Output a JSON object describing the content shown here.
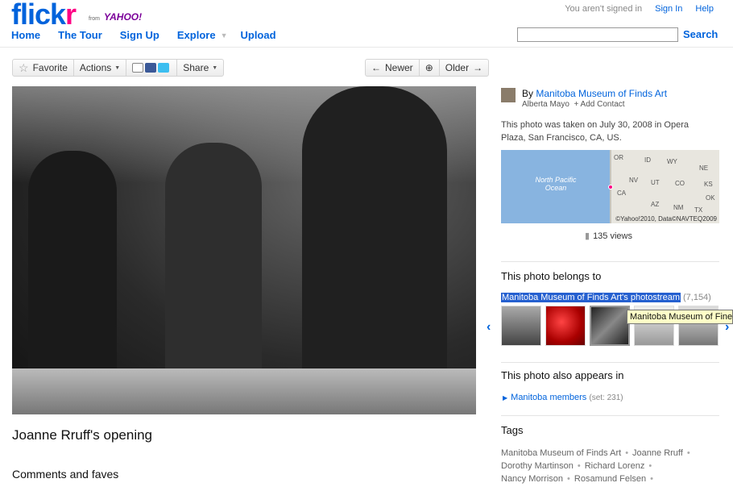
{
  "brand": {
    "flick": "flick",
    "r": "r",
    "from": "from",
    "yahoo": "YAHOO!"
  },
  "nav": {
    "home": "Home",
    "tour": "The Tour",
    "signup": "Sign Up",
    "explore": "Explore",
    "upload": "Upload"
  },
  "account": {
    "status": "You aren't signed in",
    "signin": "Sign In",
    "help": "Help"
  },
  "search": {
    "button": "Search",
    "value": ""
  },
  "toolbar": {
    "favorite": "Favorite",
    "actions": "Actions",
    "share": "Share"
  },
  "photo_nav": {
    "newer": "Newer",
    "older": "Older"
  },
  "photo": {
    "title": "Joanne Rruff's opening",
    "comments_heading": "Comments and faves"
  },
  "owner": {
    "by_prefix": "By",
    "name": "Manitoba Museum of Finds Art",
    "realname": "Alberta Mayo",
    "add_contact": "+ Add Contact"
  },
  "taken": "This photo was taken on July 30, 2008 in Opera Plaza, San Francisco, CA, US.",
  "map": {
    "ocean": "North Pacific Ocean",
    "states": [
      "OR",
      "ID",
      "WY",
      "NE",
      "NV",
      "UT",
      "CO",
      "KS",
      "CA",
      "AZ",
      "NM",
      "OK",
      "TX"
    ],
    "credit": "©Yahoo!2010, Data©NAVTEQ2009"
  },
  "views": "135 views",
  "belongs": {
    "heading": "This photo belongs to",
    "stream": "Manitoba Museum of Finds Art's photostream",
    "count": "(7,154)",
    "tooltip": "Manitoba Museum of Fine"
  },
  "appears": {
    "heading": "This photo also appears in",
    "set_name": "Manitoba members",
    "set_meta": "(set: 231)"
  },
  "tags": {
    "heading": "Tags",
    "items": [
      "Manitoba Museum of Finds Art",
      "Joanne Rruff",
      "Dorothy Martinson",
      "Richard Lorenz",
      "Nancy Morrison",
      "Rosamund Felsen"
    ]
  },
  "colors": {
    "link": "#0063dc",
    "pink": "#ff0084",
    "selection": "#2560d0"
  }
}
